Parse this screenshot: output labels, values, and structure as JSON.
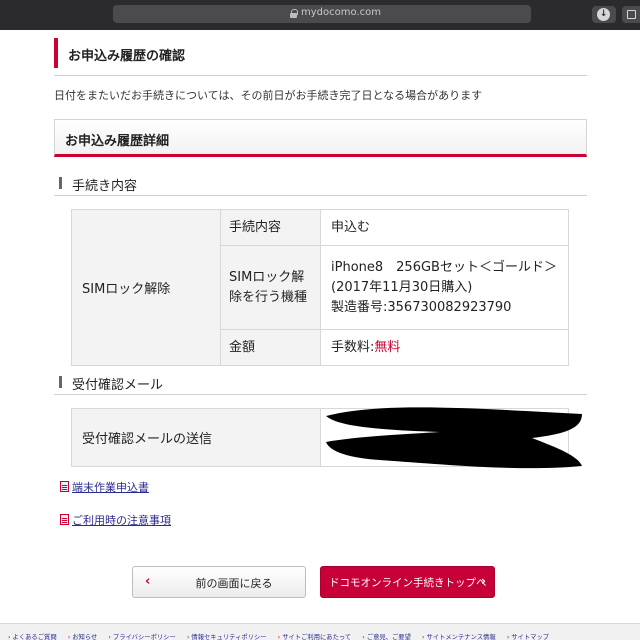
{
  "browser": {
    "url": "mydocomo.com",
    "reload_icon": "reload-icon",
    "download_icon": "download-icon",
    "tabs_icon": "tabs-icon"
  },
  "page": {
    "title": "お申込み履歴の確認",
    "notice": "日付をまたいだお手続きについては、その前日がお手続き完了日となる場合があります",
    "detail_title": "お申込み履歴詳細"
  },
  "procedure": {
    "heading": "手続き内容",
    "category": "SIMロック解除",
    "rows": [
      {
        "label": "手続内容",
        "value": "申込む"
      },
      {
        "label": "SIMロック解除を行う機種",
        "value_line1": "iPhone8　256GBセット＜ゴールド＞(2017年11月30日購入)",
        "value_line2": "製造番号:356730082923790"
      },
      {
        "label": "金額",
        "fee_prefix": "手数料:",
        "fee_value": "無料"
      }
    ]
  },
  "mail": {
    "heading": "受付確認メール",
    "label": "受付確認メールの送信"
  },
  "links": {
    "form": "端末作業申込書",
    "caution": "ご利用時の注意事項"
  },
  "buttons": {
    "back": "前の画面に戻る",
    "top": "ドコモオンライン手続きトップへ"
  },
  "footer": {
    "items": [
      "よくあるご質問",
      "お知らせ",
      "プライバシーポリシー",
      "情報セキュリティポリシー",
      "サイトご利用にあたって",
      "ご意見、ご要望",
      "サイトメンテナンス情報",
      "サイトマップ"
    ]
  },
  "colors": {
    "accent": "#cc0033",
    "link": "#2b2b8f"
  }
}
